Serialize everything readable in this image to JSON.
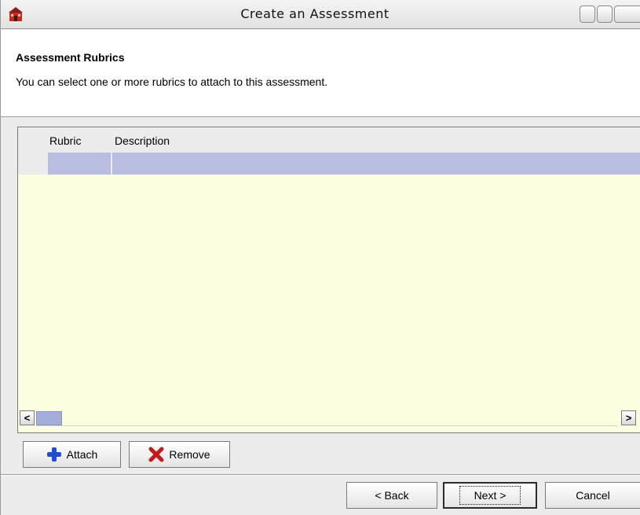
{
  "window": {
    "title": "Create an Assessment"
  },
  "header": {
    "title": "Assessment Rubrics",
    "description": "You can select one or more rubrics to attach to this assessment."
  },
  "table": {
    "columns": [
      "Rubric",
      "Description"
    ],
    "rows": []
  },
  "actions": {
    "attach_label": "Attach",
    "remove_label": "Remove"
  },
  "footer": {
    "back_label": "< Back",
    "next_label": "Next >",
    "cancel_label": "Cancel"
  },
  "icons": {
    "app": "schoolhouse-icon",
    "attach": "plus-icon",
    "remove": "x-icon",
    "scroll_left": "chevron-left-icon",
    "scroll_right": "chevron-right-icon"
  },
  "colors": {
    "table_background": "#fefee1",
    "selection": "#b9bde0",
    "attach_icon": "#1f4fd0",
    "remove_icon": "#c41a1a"
  }
}
